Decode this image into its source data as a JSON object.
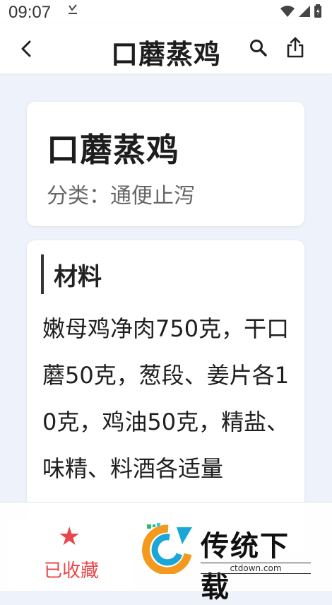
{
  "status_bar": {
    "time": "09:07"
  },
  "nav": {
    "title": "口蘑蒸鸡",
    "icons": [
      "back-icon",
      "search-icon",
      "share-icon"
    ]
  },
  "recipe": {
    "title": "口蘑蒸鸡",
    "category_line": "分类：通便止泻"
  },
  "materials": {
    "heading": "材料",
    "text": "嫩母鸡净肉750克，干口蘑50克，葱段、姜片各10克，鸡油50克，精盐、味精、料酒各适量"
  },
  "bottom": {
    "favorite_label": "已收藏",
    "favorite_icon": "star-icon",
    "accent": "#e8464a"
  },
  "watermark": {
    "title": "传统下载",
    "site": "ctdown.com"
  }
}
